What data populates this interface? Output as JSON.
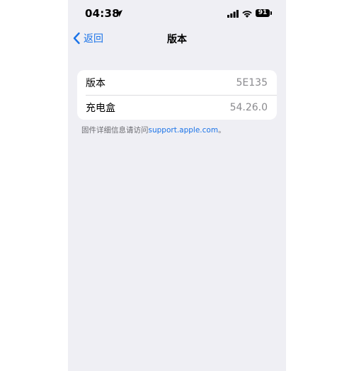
{
  "status_bar": {
    "time": "04:38",
    "battery_level": "91"
  },
  "nav": {
    "back_label": "返回",
    "title": "版本"
  },
  "rows": [
    {
      "label": "版本",
      "value": "5E135"
    },
    {
      "label": "充电盒",
      "value": "54.26.0"
    }
  ],
  "footer": {
    "prefix": "固件详细信息请访问",
    "link": "support.apple.com",
    "suffix": "。"
  },
  "colors": {
    "accent": "#1a73e8",
    "background": "#efeff4"
  }
}
